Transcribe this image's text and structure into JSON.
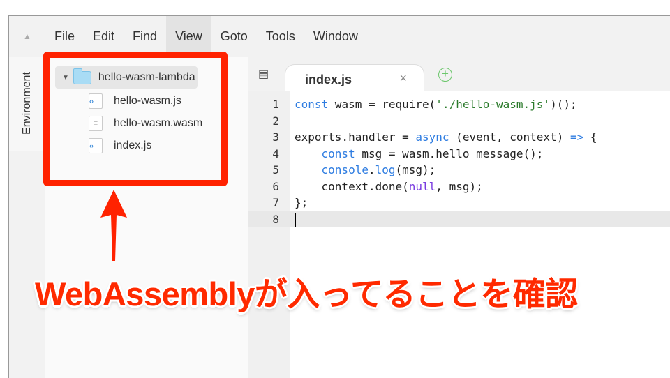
{
  "menubar": {
    "items": [
      "File",
      "Edit",
      "Find",
      "View",
      "Goto",
      "Tools",
      "Window"
    ],
    "active": "View"
  },
  "sidebar": {
    "tab_label": "Environment"
  },
  "tree": {
    "root": "hello-wasm-lambda",
    "files": [
      {
        "name": "hello-wasm.js",
        "icon": "js-file-icon"
      },
      {
        "name": "hello-wasm.wasm",
        "icon": "document-file-icon"
      },
      {
        "name": "index.js",
        "icon": "js-file-icon"
      }
    ]
  },
  "editor": {
    "tab": "index.js",
    "close": "×",
    "add": "+",
    "lines": [
      [
        {
          "t": "const",
          "k": "kw"
        },
        {
          "t": " wasm = require("
        },
        {
          "t": "'./hello-wasm.js'",
          "k": "str"
        },
        {
          "t": ")();"
        }
      ],
      [],
      [
        {
          "t": "exports.handler = "
        },
        {
          "t": "async",
          "k": "kw"
        },
        {
          "t": " (event, context) "
        },
        {
          "t": "=>",
          "k": "kw"
        },
        {
          "t": " {"
        }
      ],
      [
        {
          "t": "    "
        },
        {
          "t": "const",
          "k": "kw"
        },
        {
          "t": " msg = wasm.hello_message();"
        }
      ],
      [
        {
          "t": "    "
        },
        {
          "t": "console",
          "k": "kw"
        },
        {
          "t": "."
        },
        {
          "t": "log",
          "k": "kw"
        },
        {
          "t": "(msg);"
        }
      ],
      [
        {
          "t": "    context.done("
        },
        {
          "t": "null",
          "k": "nul"
        },
        {
          "t": ", msg);"
        }
      ],
      [
        {
          "t": "};"
        }
      ],
      []
    ],
    "current_line": 8
  },
  "annotation": {
    "caption": "WebAssemblyが入ってることを確認",
    "color": "#ff2200"
  }
}
